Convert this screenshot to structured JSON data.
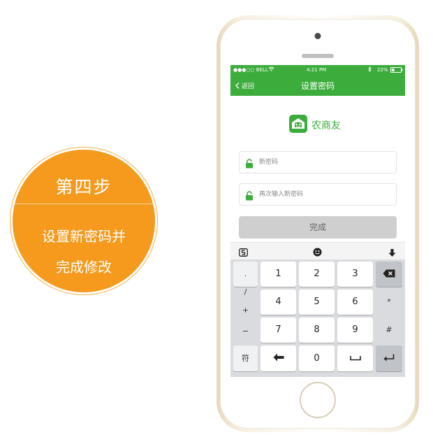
{
  "badge": {
    "title": "第四步",
    "desc_line1": "设置新密码并",
    "desc_line2": "完成修改"
  },
  "status_bar": {
    "carrier": "●●●○○ BELL",
    "time": "4:21 PM",
    "battery": "22%"
  },
  "nav": {
    "back_label": "返回",
    "title": "设置密码"
  },
  "logo": {
    "text": "农商友"
  },
  "form": {
    "new_password_placeholder": "新密码",
    "confirm_password_placeholder": "再次输入新密码",
    "submit_label": "完成"
  },
  "keyboard": {
    "side_keys": [
      ".",
      "/",
      "+",
      "−"
    ],
    "bottom_left": "符",
    "rows": [
      [
        "1",
        "2",
        "3"
      ],
      [
        "4",
        "5",
        "6"
      ],
      [
        "7",
        "8",
        "9"
      ]
    ],
    "right_keys": [
      "*",
      "#"
    ],
    "zero": "0"
  },
  "colors": {
    "accent_green": "#3cad3c",
    "badge_orange": "#f59a1c"
  }
}
